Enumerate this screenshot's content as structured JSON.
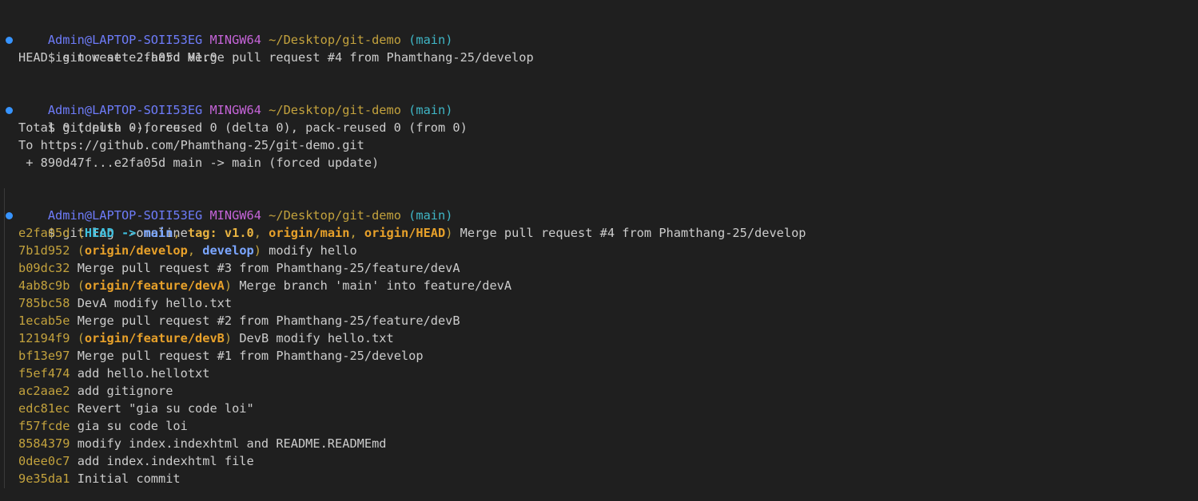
{
  "colors": {
    "user": "#6e7cfa",
    "mingw": "#c564d8",
    "path": "#c3a23d",
    "branch": "#3fb6c6",
    "hash": "#c3a23d",
    "head": "#3fc1e0",
    "local_branch": "#7ba6ff",
    "tag": "#e8b341",
    "remote": "#e8a12a",
    "text": "#cccccc",
    "dot": "#3794ff"
  },
  "blocks": [
    {
      "prompt": {
        "user": "Admin@LAPTOP-SOII53EG",
        "env": "MINGW64",
        "path": "~/Desktop/git-demo",
        "branch": "(main)"
      },
      "command": "$ git reset --hard v1.0",
      "output": [
        "HEAD is now at e2fa05d Merge pull request #4 from Phamthang-25/develop"
      ]
    },
    {
      "prompt": {
        "user": "Admin@LAPTOP-SOII53EG",
        "env": "MINGW64",
        "path": "~/Desktop/git-demo",
        "branch": "(main)"
      },
      "command": "$ git push --force",
      "output": [
        "Total 0 (delta 0), reused 0 (delta 0), pack-reused 0 (from 0)",
        "To https://github.com/Phamthang-25/git-demo.git",
        " + 890d47f...e2fa05d main -> main (forced update)"
      ]
    },
    {
      "prompt": {
        "user": "Admin@LAPTOP-SOII53EG",
        "env": "MINGW64",
        "path": "~/Desktop/git-demo",
        "branch": "(main)"
      },
      "command": "$ git log --oneline"
    }
  ],
  "log": [
    {
      "hash": "e2fa05d",
      "refs": [
        {
          "t": "HEAD -> ",
          "c": "head",
          "b": true
        },
        {
          "t": "main",
          "c": "local_branch",
          "b": true
        },
        {
          "t": ", ",
          "c": "text",
          "b": false
        },
        {
          "t": "tag: v1.0",
          "c": "tag",
          "b": true
        },
        {
          "t": ", ",
          "c": "text",
          "b": false
        },
        {
          "t": "origin/main",
          "c": "remote",
          "b": true
        },
        {
          "t": ", ",
          "c": "text",
          "b": false
        },
        {
          "t": "origin/HEAD",
          "c": "remote",
          "b": true
        }
      ],
      "msg": "Merge pull request #4 from Phamthang-25/develop"
    },
    {
      "hash": "7b1d952",
      "refs": [
        {
          "t": "origin/develop",
          "c": "remote",
          "b": true
        },
        {
          "t": ", ",
          "c": "text",
          "b": false
        },
        {
          "t": "develop",
          "c": "local_branch",
          "b": true
        }
      ],
      "msg": "modify hello"
    },
    {
      "hash": "b09dc32",
      "refs": [],
      "msg": "Merge pull request #3 from Phamthang-25/feature/devA"
    },
    {
      "hash": "4ab8c9b",
      "refs": [
        {
          "t": "origin/feature/devA",
          "c": "remote",
          "b": true
        }
      ],
      "msg": "Merge branch 'main' into feature/devA"
    },
    {
      "hash": "785bc58",
      "refs": [],
      "msg": "DevA modify hello.txt"
    },
    {
      "hash": "1ecab5e",
      "refs": [],
      "msg": "Merge pull request #2 from Phamthang-25/feature/devB"
    },
    {
      "hash": "12194f9",
      "refs": [
        {
          "t": "origin/feature/devB",
          "c": "remote",
          "b": true
        }
      ],
      "msg": "DevB modify hello.txt"
    },
    {
      "hash": "bf13e97",
      "refs": [],
      "msg": "Merge pull request #1 from Phamthang-25/develop"
    },
    {
      "hash": "f5ef474",
      "refs": [],
      "msg": "add hello.hellotxt"
    },
    {
      "hash": "ac2aae2",
      "refs": [],
      "msg": "add gitignore"
    },
    {
      "hash": "edc81ec",
      "refs": [],
      "msg": "Revert \"gia su code loi\""
    },
    {
      "hash": "f57fcde",
      "refs": [],
      "msg": "gia su code loi"
    },
    {
      "hash": "8584379",
      "refs": [],
      "msg": "modify index.indexhtml and README.READMEmd"
    },
    {
      "hash": "0dee0c7",
      "refs": [],
      "msg": "add index.indexhtml file"
    },
    {
      "hash": "9e35da1",
      "refs": [],
      "msg": "Initial commit"
    }
  ]
}
